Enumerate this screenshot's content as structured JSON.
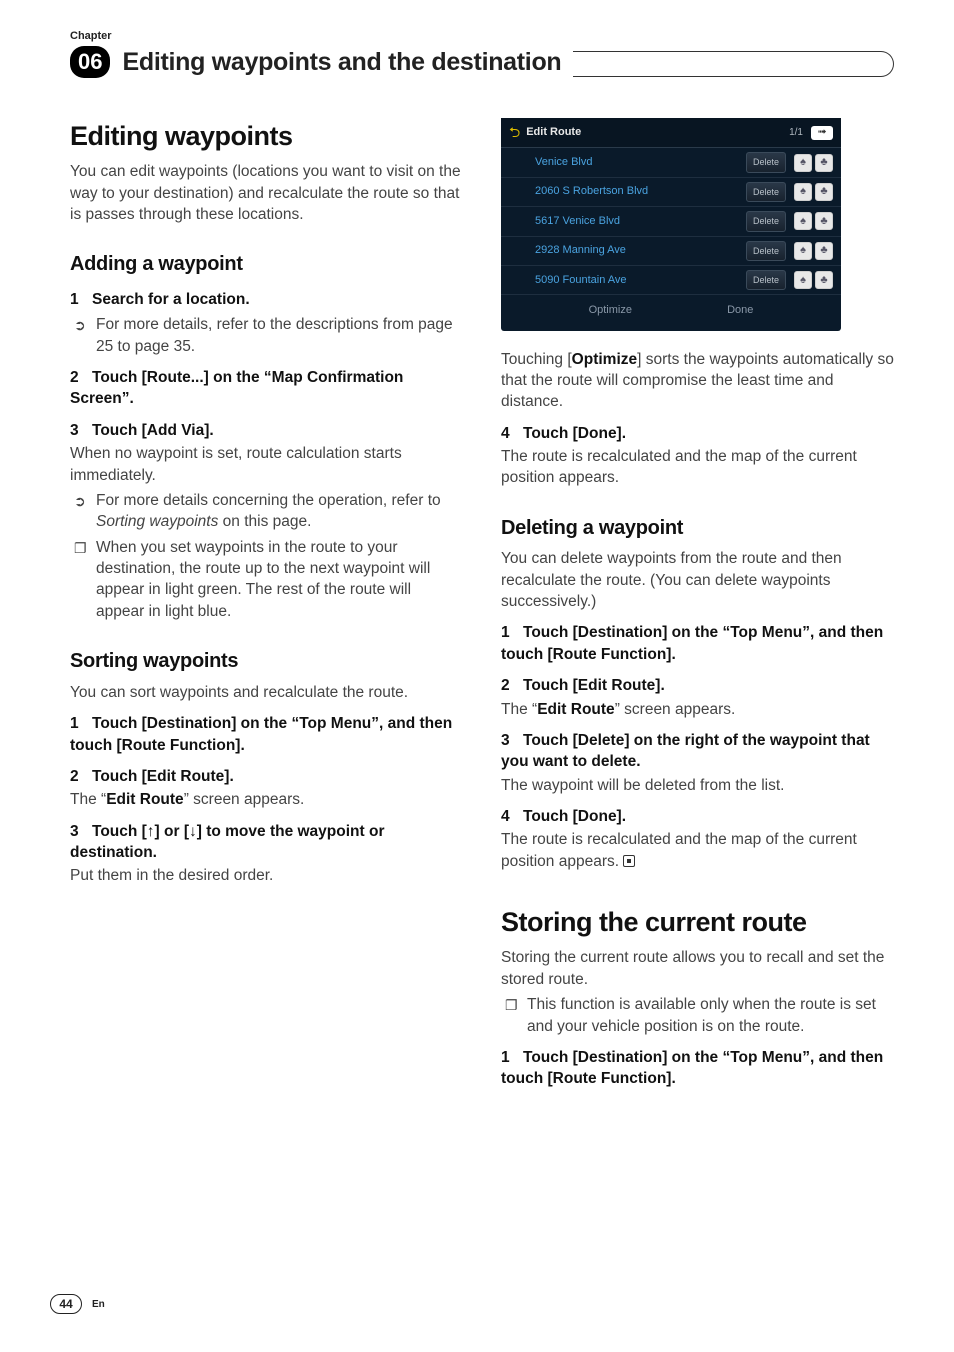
{
  "chapter": {
    "label": "Chapter",
    "number": "06",
    "title": "Editing waypoints and the destination"
  },
  "left": {
    "h1": "Editing waypoints",
    "intro": "You can edit waypoints (locations you want to visit on the way to your destination) and recalculate the route so that is passes through these locations.",
    "adding": {
      "h2": "Adding a waypoint",
      "s1": "Search for a location.",
      "b1": "For more details, refer to the descriptions from page 25 to page 35.",
      "s2": "Touch [Route...] on the “Map Confirmation Screen”.",
      "s3": "Touch [Add Via].",
      "p3": "When no waypoint is set, route calculation starts immediately.",
      "b3a_pre": "For more details concerning the operation, refer to ",
      "b3a_it": "Sorting waypoints",
      "b3a_post": " on this page.",
      "b3b": "When you set waypoints in the route to your destination, the route up to the next waypoint will appear in light green. The rest of the route will appear in light blue."
    },
    "sorting": {
      "h2": "Sorting waypoints",
      "intro": "You can sort waypoints and recalculate the route.",
      "s1": "Touch [Destination] on the “Top Menu”, and then touch [Route Function].",
      "s2": "Touch [Edit Route].",
      "p2a": "The “",
      "p2b": "Edit Route",
      "p2c": "” screen appears.",
      "s3": "Touch [↑] or [↓] to move the waypoint or destination.",
      "p3": "Put them in the desired order."
    }
  },
  "right": {
    "shot": {
      "title": "Edit Route",
      "pager": "1/1",
      "rows": [
        {
          "name": "Venice Blvd",
          "del": "Delete"
        },
        {
          "name": "2060 S Robertson Blvd",
          "del": "Delete"
        },
        {
          "name": "5617 Venice Blvd",
          "del": "Delete"
        },
        {
          "name": "2928 Manning Ave",
          "del": "Delete"
        },
        {
          "name": "5090 Fountain Ave",
          "del": "Delete"
        }
      ],
      "optimize": "Optimize",
      "done": "Done"
    },
    "opt_a": "Touching [",
    "opt_b": "Optimize",
    "opt_c": "] sorts the waypoints automatically so that the route will compromise the least time  and distance.",
    "s4": "Touch [Done].",
    "p4": "The route is recalculated and the map of the current position appears.",
    "deleting": {
      "h2": "Deleting a waypoint",
      "intro": "You can delete waypoints from the route and then recalculate the route. (You can delete waypoints successively.)",
      "s1": "Touch [Destination] on the “Top Menu”, and then touch [Route Function].",
      "s2": "Touch [Edit Route].",
      "p2a": "The “",
      "p2b": "Edit Route",
      "p2c": "” screen appears.",
      "s3": "Touch [Delete] on the right of the waypoint that you want to delete.",
      "p3": "The waypoint will be deleted from the list.",
      "s4": "Touch [Done].",
      "p4": "The route is recalculated and the map of the current position appears."
    },
    "storing": {
      "h1": "Storing the current route",
      "intro": "Storing the current route allows you to recall and set the stored route.",
      "b1": "This function is available only when the route is set and your vehicle position is on the route.",
      "s1": "Touch [Destination] on the “Top Menu”, and then touch [Route Function]."
    }
  },
  "footer": {
    "page": "44",
    "lang": "En"
  }
}
